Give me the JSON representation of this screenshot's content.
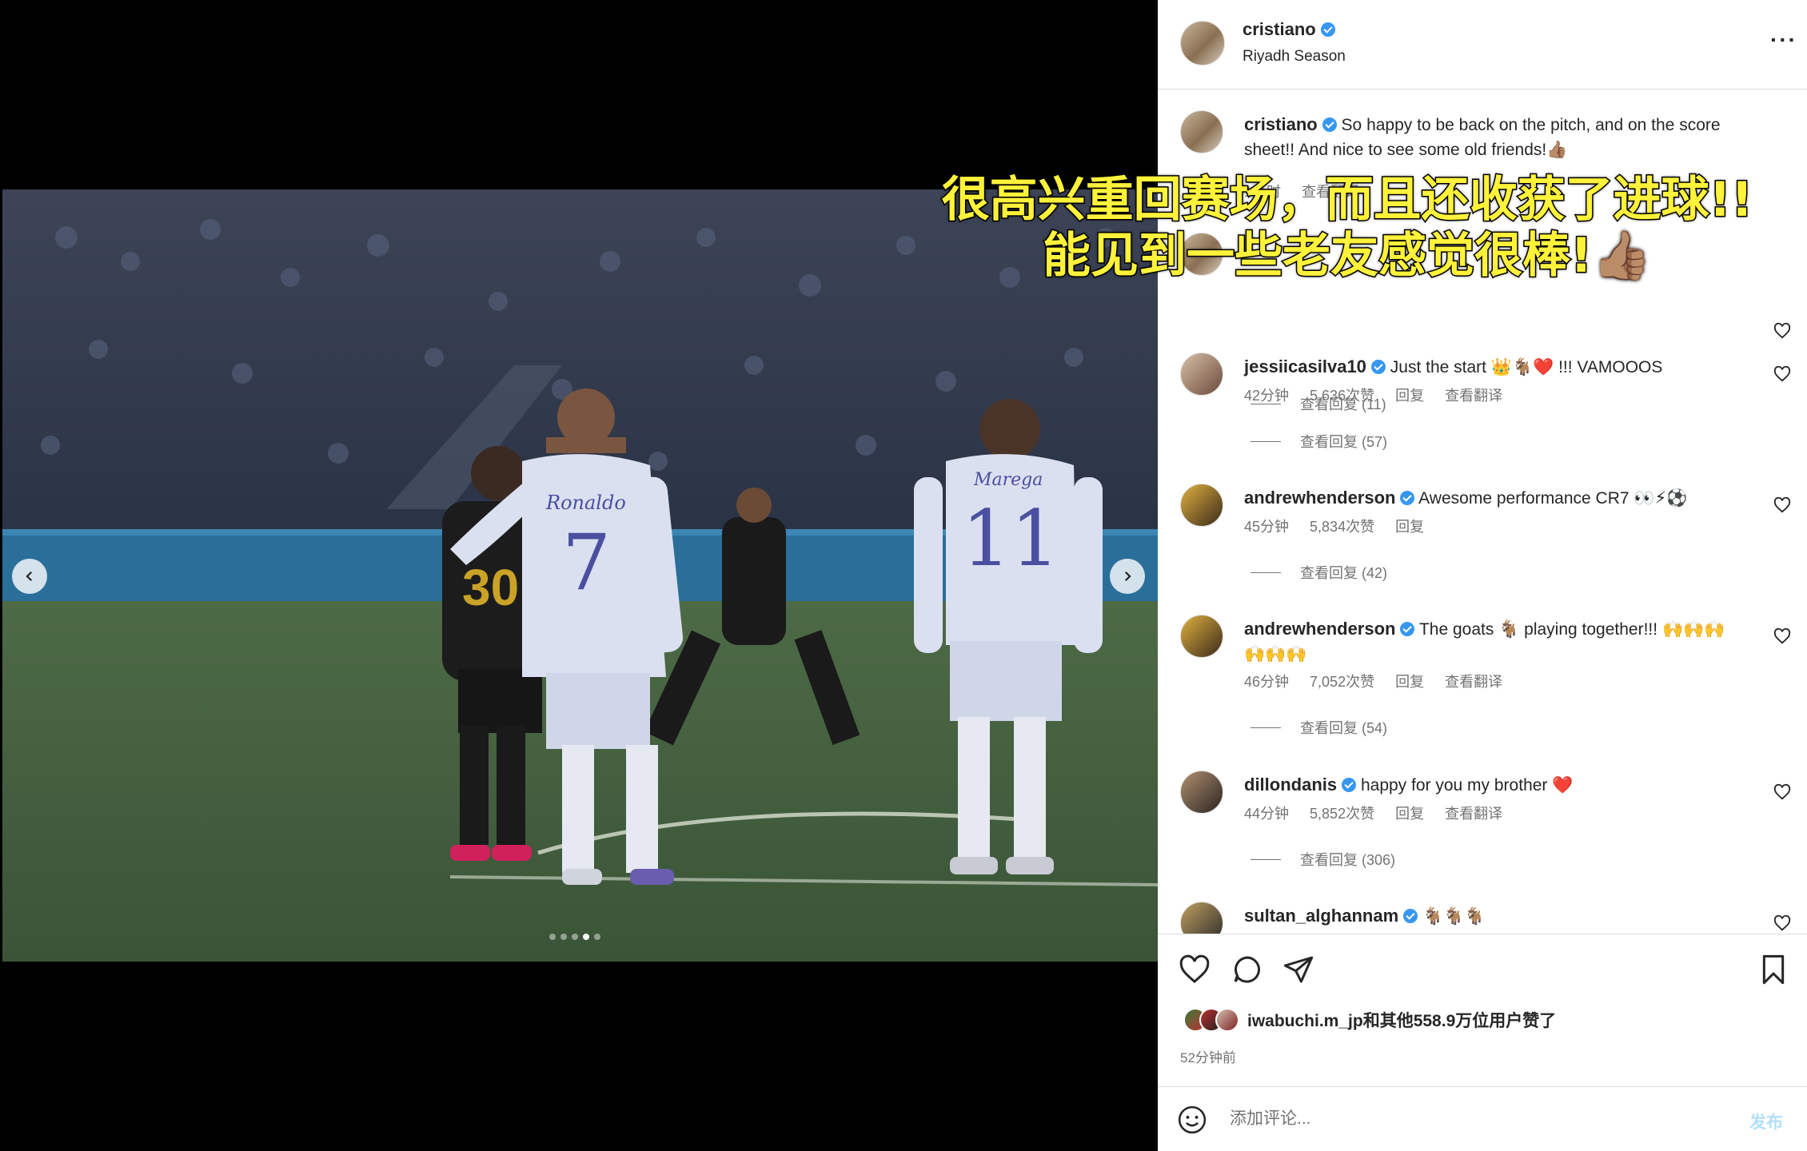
{
  "post": {
    "author": "cristiano",
    "location": "Riyadh Season",
    "more_label": "···"
  },
  "carousel": {
    "total": 5,
    "active_index": 3
  },
  "caption_comment": {
    "username": "cristiano",
    "text": "So happy to be back on the pitch, and on the score sheet!! And nice to see some old friends!👍🏽",
    "time": "1小时",
    "action": "查看翻译"
  },
  "overlay": {
    "line1": "很高兴重回赛场，而且还收获了进球!!",
    "line2": "能见到一些老友感觉很棒!👍🏽"
  },
  "comments": [
    {
      "replies": "查看回复 (11)"
    },
    {
      "username": "jessiicasilva10",
      "verified": true,
      "text": "Just the start 👑🐐❤️ !!! VAMOOOS",
      "time": "42分钟",
      "likes": "5,636次赞",
      "reply": "回复",
      "translate": "查看翻译",
      "replies": "查看回复 (57)"
    },
    {
      "username": "andrewhenderson",
      "verified": true,
      "text": "Awesome performance CR7 👀⚡⚽",
      "time": "45分钟",
      "likes": "5,834次赞",
      "reply": "回复",
      "translate": "",
      "replies": "查看回复 (42)"
    },
    {
      "username": "andrewhenderson",
      "verified": true,
      "text": "The goats 🐐 playing together!!! 🙌🙌🙌🙌🙌🙌",
      "time": "46分钟",
      "likes": "7,052次赞",
      "reply": "回复",
      "translate": "查看翻译",
      "replies": "查看回复 (54)"
    },
    {
      "username": "dillondanis",
      "verified": true,
      "text": "happy for you my brother ❤️",
      "time": "44分钟",
      "likes": "5,852次赞",
      "reply": "回复",
      "translate": "查看翻译",
      "replies": "查看回复 (306)"
    },
    {
      "username": "sultan_alghannam",
      "verified": true,
      "text": "🐐🐐🐐"
    }
  ],
  "actions": {
    "likes_text": "iwabuchi.m_jp和其他558.9万位用户赞了",
    "time_ago": "52分钟前"
  },
  "composer": {
    "placeholder": "添加评论...",
    "post_label": "发布"
  },
  "icons": {
    "like": "heart-icon",
    "comment": "comment-icon",
    "share": "share-icon",
    "save": "bookmark-icon",
    "emoji": "emoji-icon"
  },
  "colors": {
    "verified": "#3797f0",
    "overlay_text": "#fff23a",
    "post_button": "#b2dffc"
  }
}
